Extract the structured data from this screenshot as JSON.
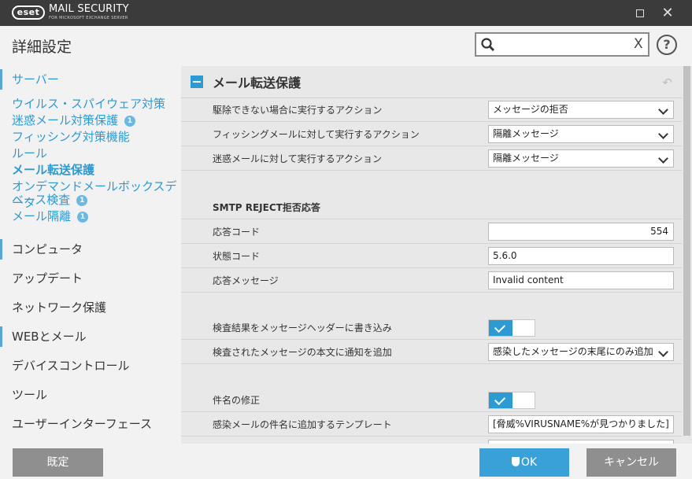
{
  "window": {
    "logo": "eset",
    "product": "MAIL SECURITY",
    "product_sub": "FOR MICROSOFT EXCHANGE SERVER",
    "close_glyph": "✕"
  },
  "header": {
    "title": "詳細設定",
    "search_value": "",
    "clear_glyph": "X",
    "help_glyph": "?"
  },
  "sidebar": {
    "server": "サーバー",
    "sub": [
      {
        "label": "ウイルス・スパイウェア対策"
      },
      {
        "label": "迷惑メール対策保護",
        "badge": "1"
      },
      {
        "label": "フィッシング対策機能"
      },
      {
        "label": "ルール"
      },
      {
        "label": "メール転送保護"
      },
      {
        "label": "オンデマンドメールボックスデータ"
      },
      {
        "label": "ベース検査",
        "badge": "1"
      },
      {
        "label": "メール隔離",
        "badge": "1"
      }
    ],
    "sections": [
      "コンピュータ",
      "アップデート",
      "ネットワーク保護",
      "WEBとメール",
      "デバイスコントロール",
      "ツール",
      "ユーザーインターフェース"
    ]
  },
  "content": {
    "title": "メール転送保護",
    "undo_glyph": "↶",
    "rows": [
      {
        "label": "駆除できない場合に実行するアクション",
        "value": "メッセージの拒否"
      },
      {
        "label": "フィッシングメールに対して実行するアクション",
        "value": "隔離メッセージ"
      },
      {
        "label": "迷惑メールに対して実行するアクション",
        "value": "隔離メッセージ"
      },
      {
        "label": "SMTP REJECT拒否応答"
      },
      {
        "label": "応答コード",
        "value": "554"
      },
      {
        "label": "状態コード",
        "value": "5.6.0"
      },
      {
        "label": "応答メッセージ",
        "value": "Invalid content"
      },
      {
        "label": "検査結果をメッセージヘッダーに書き込み",
        "on": true
      },
      {
        "label": "検査されたメッセージの本文に通知を追加",
        "value": "感染したメッセージの末尾にのみ追加"
      },
      {
        "label": "件名の修正",
        "on": true
      },
      {
        "label": "感染メールの件名に追加するテンプレート",
        "value": "[脅威%VIRUSNAME%が見つかりました]"
      }
    ]
  },
  "footer": {
    "default": "既定",
    "ok": "OK",
    "cancel": "キャンセル"
  }
}
